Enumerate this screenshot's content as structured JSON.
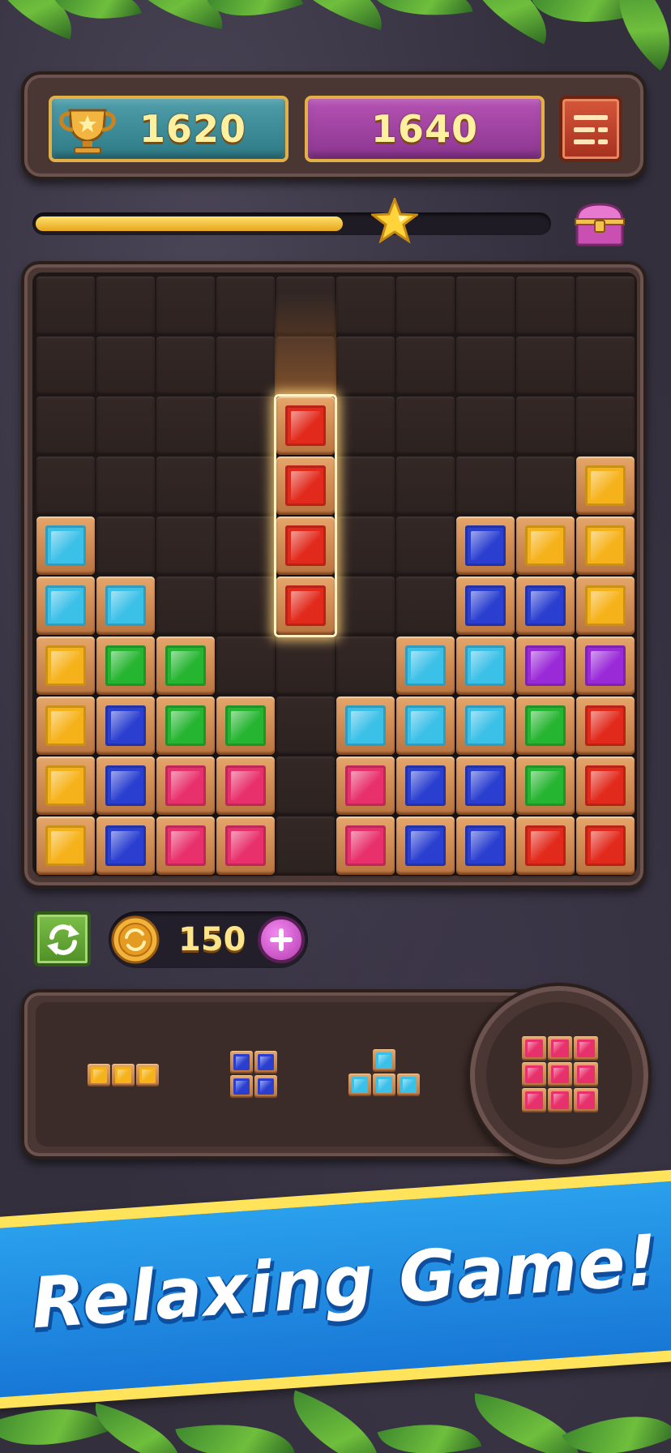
{
  "header": {
    "best_score": "1620",
    "current_score": "1640",
    "icons": {
      "trophy": "trophy-icon",
      "menu": "menu-icon"
    }
  },
  "progress": {
    "level_fraction": 0.6,
    "icons": {
      "star": "star-icon",
      "chest": "treasure-chest-icon"
    }
  },
  "colors": {
    "red": "#e22a1c",
    "yellow": "#f6b21a",
    "cyan": "#3bc0e8",
    "blue": "#2a3fd0",
    "green": "#26b531",
    "pink": "#e8316c",
    "purple": "#9a2ad8",
    "best_score_box": "#2d7a86",
    "current_score_box": "#8b3590",
    "banner": "#1877d6"
  },
  "board": {
    "rows": 10,
    "cols": 10,
    "grid": [
      "..........",
      "..........",
      "....r.....",
      "....r....y",
      "c......byy",
      "cc.....bby",
      "ygg...ccpp",
      "ybgg.cc ggr",
      "ybnn.nbbgr",
      "ybnn.nbbrr"
    ],
    "active_piece": {
      "color": "red",
      "cells": [
        [
          2,
          4
        ],
        [
          3,
          4
        ],
        [
          4,
          4
        ],
        [
          5,
          4
        ]
      ]
    }
  },
  "coins": {
    "count": "150",
    "icons": {
      "coin": "coin-icon",
      "add": "plus-icon",
      "refresh": "refresh-icon"
    }
  },
  "tray": {
    "pieces": [
      {
        "name": "piece-line-3",
        "color": "yellow",
        "cells": [
          [
            0,
            0
          ],
          [
            0,
            1
          ],
          [
            0,
            2
          ]
        ]
      },
      {
        "name": "piece-square-2",
        "color": "blue",
        "cells": [
          [
            0,
            0
          ],
          [
            0,
            1
          ],
          [
            1,
            0
          ],
          [
            1,
            1
          ]
        ]
      },
      {
        "name": "piece-t",
        "color": "cyan",
        "cells": [
          [
            0,
            1
          ],
          [
            1,
            0
          ],
          [
            1,
            1
          ],
          [
            1,
            2
          ]
        ]
      }
    ],
    "hold_piece": {
      "name": "piece-square-3",
      "color": "pink",
      "cells": [
        [
          0,
          0
        ],
        [
          0,
          1
        ],
        [
          0,
          2
        ],
        [
          1,
          0
        ],
        [
          1,
          1
        ],
        [
          1,
          2
        ],
        [
          2,
          0
        ],
        [
          2,
          1
        ],
        [
          2,
          2
        ]
      ]
    }
  },
  "banner": {
    "text": "Relaxing Game!"
  }
}
